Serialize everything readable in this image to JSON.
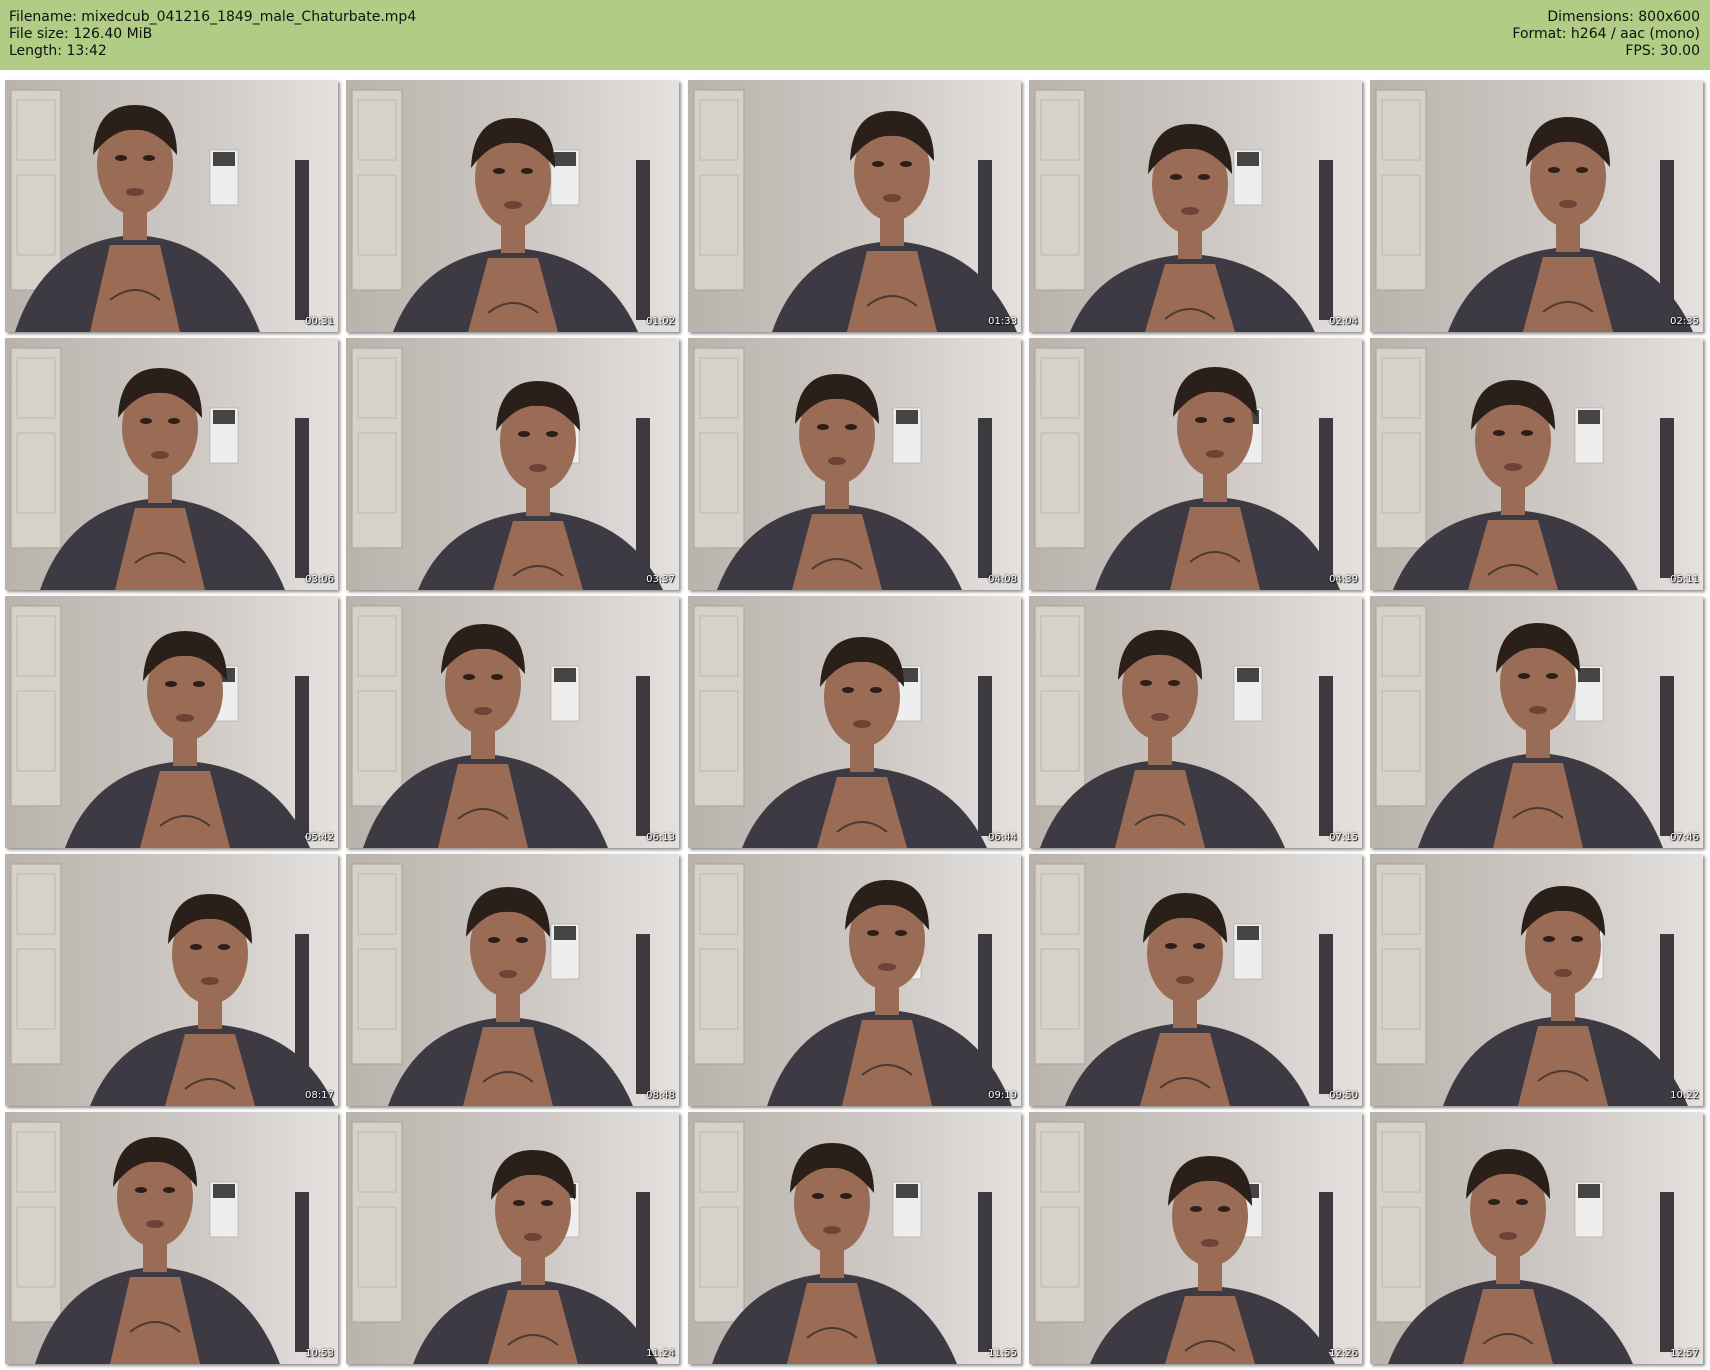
{
  "header": {
    "filename": "Filename: mixedcub_041216_1849_male_Chaturbate.mp4",
    "filesize": "File size: 126.40 MiB",
    "length": "Length: 13:42",
    "dimensions": "Dimensions: 800x600",
    "format": "Format: h264 / aac (mono)",
    "fps": "FPS: 30.00"
  },
  "colors": {
    "header_bg": "#b1cd85",
    "wall": "#cfcac6",
    "robe": "#3e3a44",
    "skin": "#9a6c55",
    "hair": "#2a2019"
  },
  "frames": [
    {
      "time": "00:31"
    },
    {
      "time": "01:02"
    },
    {
      "time": "01:33"
    },
    {
      "time": "02:04"
    },
    {
      "time": "02:35"
    },
    {
      "time": "03:06"
    },
    {
      "time": "03:37"
    },
    {
      "time": "04:08"
    },
    {
      "time": "04:39"
    },
    {
      "time": "05:11"
    },
    {
      "time": "05:42"
    },
    {
      "time": "06:13"
    },
    {
      "time": "06:44"
    },
    {
      "time": "07:15"
    },
    {
      "time": "07:46"
    },
    {
      "time": "08:17"
    },
    {
      "time": "08:48"
    },
    {
      "time": "09:19"
    },
    {
      "time": "09:50"
    },
    {
      "time": "10:22"
    },
    {
      "time": "10:53"
    },
    {
      "time": "11:24"
    },
    {
      "time": "11:55"
    },
    {
      "time": "12:26"
    },
    {
      "time": "12:57"
    }
  ]
}
